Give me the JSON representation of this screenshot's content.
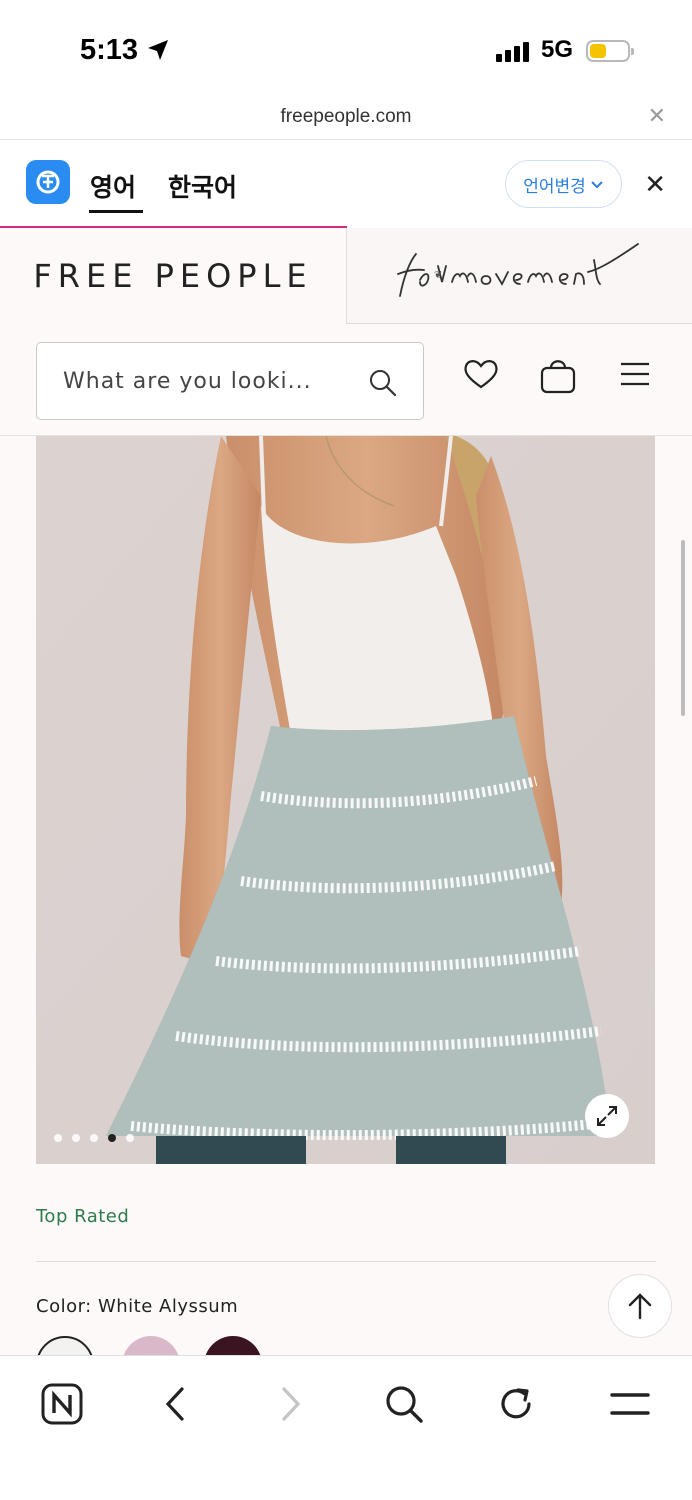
{
  "status_bar": {
    "time": "5:13",
    "network": "5G",
    "battery_level": 0.3
  },
  "browser": {
    "url": "freepeople.com",
    "url_close_icon": "close-icon"
  },
  "translator": {
    "tabs": [
      "영어",
      "한국어"
    ],
    "active_tab": "영어",
    "change_language_label": "언어변경",
    "accent_color": "#d42b7e",
    "close_icon": "close-icon"
  },
  "site": {
    "brand_primary": "FREE PEOPLE",
    "brand_secondary": "fp movement",
    "search_placeholder": "What are you looki...",
    "header_icons": [
      "search-icon",
      "heart-icon",
      "bag-icon",
      "menu-icon"
    ]
  },
  "product": {
    "carousel_total": 5,
    "carousel_active_index": 3,
    "rating_badge": "Top Rated",
    "color_label": "Color: White Alyssum",
    "swatch_colors": [
      "#f4f2f0",
      "#d9b9c9",
      "#3a1420"
    ],
    "selected_swatch_index": 0
  },
  "bottom_toolbar": {
    "icons": [
      "naver-icon",
      "back-icon",
      "forward-icon",
      "search-icon",
      "refresh-icon",
      "menu-icon"
    ]
  }
}
